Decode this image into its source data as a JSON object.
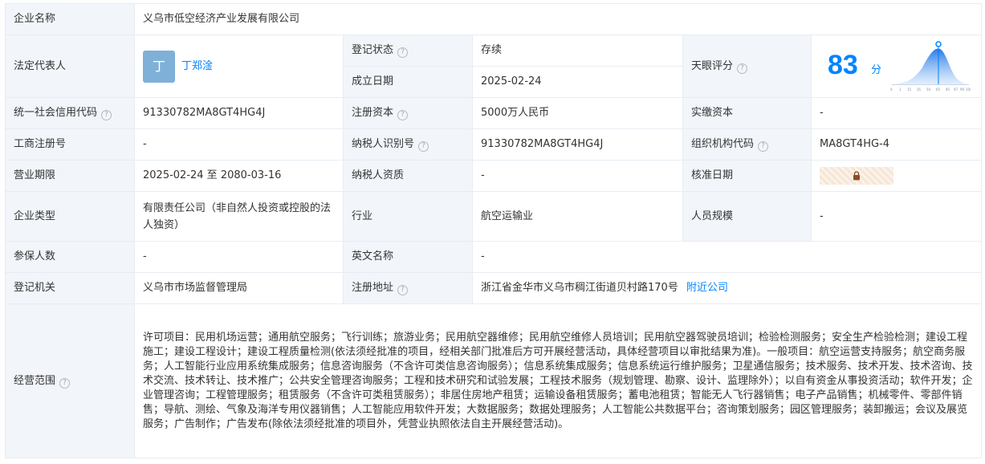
{
  "company_name": {
    "label": "企业名称",
    "value": "义乌市低空经济产业发展有限公司"
  },
  "legal_rep": {
    "label": "法定代表人",
    "avatar_char": "丁",
    "name": "丁郑淦"
  },
  "reg_status": {
    "label": "登记状态",
    "value": "存续"
  },
  "established": {
    "label": "成立日期",
    "value": "2025-02-24"
  },
  "tianyan": {
    "label": "天眼评分",
    "score": "83",
    "unit": "分",
    "axis": [
      "0",
      "1",
      "15",
      "35",
      "50",
      "65",
      "85",
      "97",
      "99",
      "100"
    ]
  },
  "credit_code": {
    "label": "统一社会信用代码",
    "value": "91330782MA8GT4HG4J"
  },
  "reg_capital": {
    "label": "注册资本",
    "value": "5000万人民币"
  },
  "paid_capital": {
    "label": "实缴资本",
    "value": "-"
  },
  "business_reg_no": {
    "label": "工商注册号",
    "value": "-"
  },
  "taxpayer_id": {
    "label": "纳税人识别号",
    "value": "91330782MA8GT4HG4J"
  },
  "org_code": {
    "label": "组织机构代码",
    "value": "MA8GT4HG-4"
  },
  "term": {
    "label": "营业期限",
    "value": "2025-02-24 至 2080-03-16"
  },
  "taxpayer_qual": {
    "label": "纳税人资质",
    "value": "-"
  },
  "approval_date": {
    "label": "核准日期",
    "icon": "lock-icon"
  },
  "company_type": {
    "label": "企业类型",
    "value": "有限责任公司（非自然人投资或控股的法人独资）"
  },
  "industry": {
    "label": "行业",
    "value": "航空运输业"
  },
  "staff_size": {
    "label": "人员规模",
    "value": "-"
  },
  "insured": {
    "label": "参保人数",
    "value": "-"
  },
  "english_name": {
    "label": "英文名称",
    "value": "-"
  },
  "reg_authority": {
    "label": "登记机关",
    "value": "义乌市市场监督管理局"
  },
  "reg_address": {
    "label": "注册地址",
    "value": "浙江省金华市义乌市稠江街道贝村路170号",
    "link": "附近公司"
  },
  "scope": {
    "label": "经营范围",
    "value": "许可项目：民用机场运营；通用航空服务；飞行训练；旅游业务；民用航空器维修；民用航空维修人员培训；民用航空器驾驶员培训；检验检测服务；安全生产检验检测；建设工程施工；建设工程设计；建设工程质量检测(依法须经批准的项目，经相关部门批准后方可开展经营活动，具体经营项目以审批结果为准)。一般项目：航空运营支持服务；航空商务服务；人工智能行业应用系统集成服务；信息咨询服务（不含许可类信息咨询服务）；信息系统集成服务；信息系统运行维护服务；卫星通信服务；技术服务、技术开发、技术咨询、技术交流、技术转让、技术推广；公共安全管理咨询服务；工程和技术研究和试验发展；工程技术服务（规划管理、勘察、设计、监理除外）；以自有资金从事投资活动；软件开发；企业管理咨询；工程管理服务；租赁服务（不含许可类租赁服务）；非居住房地产租赁；运输设备租赁服务；蓄电池租赁；智能无人飞行器销售；电子产品销售；机械零件、零部件销售；导航、测绘、气象及海洋专用仪器销售；人工智能应用软件开发；大数据服务；数据处理服务；人工智能公共数据平台；咨询策划服务；园区管理服务；装卸搬运；会议及展览服务；广告制作；广告发布(除依法须经批准的项目外，凭营业执照依法自主开展经营活动)。"
  },
  "colors": {
    "label_bg": "#f2f6fb",
    "border": "#e8ecf2",
    "link": "#0084ff",
    "status": "#07a868"
  }
}
